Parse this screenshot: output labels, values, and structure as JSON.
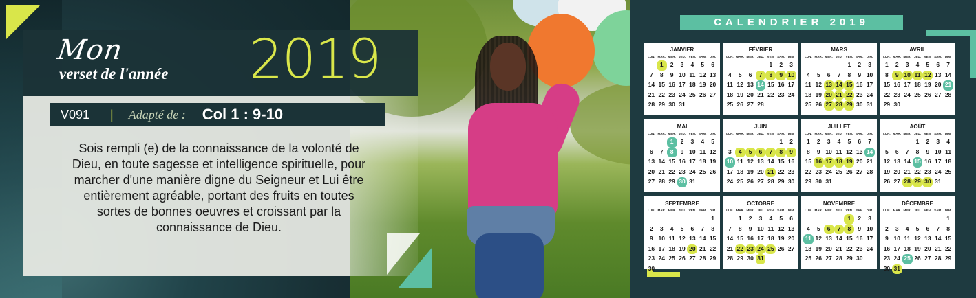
{
  "title": {
    "mon": "Mon",
    "verset": "verset de l'année",
    "year": "2019"
  },
  "reference": {
    "code": "V091",
    "separator": "|",
    "adapte": "Adapté de :",
    "verse_ref": "Col 1 : 9-10"
  },
  "verse": {
    "lines": [
      "Sois rempli (e) de la connaissance de la volonté de",
      "Dieu, en toute sagesse et intelligence spirituelle, pour",
      "marcher d'une manière digne du Seigneur et Lui être",
      "entièrement agréable, portant des fruits en toutes",
      "sortes de bonnes oeuvres et croissant par la",
      "connaissance de Dieu."
    ]
  },
  "calendar": {
    "title": "CALENDRIER 2019",
    "weekdays": [
      "LUN.",
      "MAR.",
      "MER.",
      "JEU.",
      "VEN.",
      "SAM.",
      "DIM."
    ],
    "months": [
      {
        "name": "JANVIER",
        "offset": 1,
        "days": 31,
        "highlight": [
          1
        ],
        "highlight_teal": []
      },
      {
        "name": "FÉVRIER",
        "offset": 4,
        "days": 28,
        "highlight": [
          7,
          8,
          9,
          10
        ],
        "highlight_teal": [
          14
        ]
      },
      {
        "name": "MARS",
        "offset": 4,
        "days": 31,
        "highlight": [
          13,
          14,
          15,
          20,
          21,
          22,
          27,
          28,
          29
        ],
        "highlight_teal": []
      },
      {
        "name": "AVRIL",
        "offset": 0,
        "days": 30,
        "highlight": [
          9,
          10,
          11,
          12
        ],
        "highlight_teal": [
          21
        ]
      },
      {
        "name": "MAI",
        "offset": 2,
        "days": 31,
        "highlight": [],
        "highlight_teal": [
          1,
          8,
          30
        ]
      },
      {
        "name": "JUIN",
        "offset": 5,
        "days": 30,
        "highlight": [
          4,
          5,
          6,
          7,
          8,
          9,
          21
        ],
        "highlight_teal": [
          10
        ]
      },
      {
        "name": "JUILLET",
        "offset": 0,
        "days": 31,
        "highlight": [
          16,
          17,
          18,
          19
        ],
        "highlight_teal": [
          14
        ]
      },
      {
        "name": "AOÛT",
        "offset": 3,
        "days": 31,
        "highlight": [
          28,
          29,
          30
        ],
        "highlight_teal": [
          15
        ]
      },
      {
        "name": "SEPTEMBRE",
        "offset": 6,
        "days": 30,
        "highlight": [
          20
        ],
        "highlight_teal": []
      },
      {
        "name": "OCTOBRE",
        "offset": 1,
        "days": 31,
        "highlight": [
          22,
          23,
          24,
          25,
          31
        ],
        "highlight_teal": []
      },
      {
        "name": "NOVEMBRE",
        "offset": 4,
        "days": 30,
        "highlight": [
          1,
          6,
          7,
          8
        ],
        "highlight_teal": [
          11
        ]
      },
      {
        "name": "DÉCEMBRE",
        "offset": 6,
        "days": 31,
        "highlight": [
          31
        ],
        "highlight_teal": [
          25
        ]
      }
    ]
  },
  "colors": {
    "accent_yellow": "#d9e64a",
    "accent_teal": "#5cbfa2",
    "panel_dark": "#1b3337",
    "panel_light": "#e9ece5"
  }
}
